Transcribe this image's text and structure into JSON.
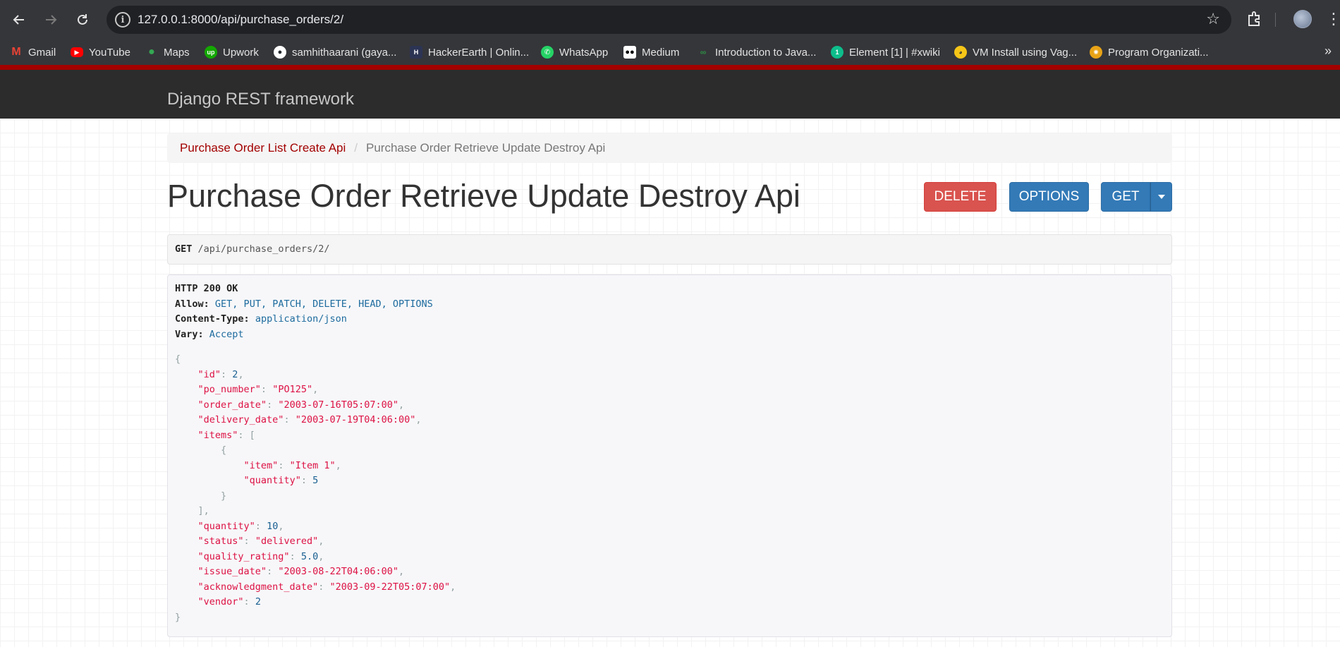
{
  "browser": {
    "url": "127.0.0.1:8000/api/purchase_orders/2/",
    "bookmarks": [
      {
        "label": "Gmail",
        "icon": "gmail-icon",
        "color": "#ea4335"
      },
      {
        "label": "YouTube",
        "icon": "youtube-icon",
        "color": "#ff0000"
      },
      {
        "label": "Maps",
        "icon": "maps-icon",
        "color": "#34a853"
      },
      {
        "label": "Upwork",
        "icon": "upwork-icon",
        "color": "#14a800"
      },
      {
        "label": "samhithaarani (gaya...",
        "icon": "github-icon",
        "color": "#ffffff"
      },
      {
        "label": "HackerEarth | Onlin...",
        "icon": "hackerearth-icon",
        "color": "#2c3454"
      },
      {
        "label": "WhatsApp",
        "icon": "whatsapp-icon",
        "color": "#25d366"
      },
      {
        "label": "Medium",
        "icon": "medium-icon",
        "color": "#000000"
      },
      {
        "label": "Introduction to Java...",
        "icon": "geeksforgeeks-icon",
        "color": "#2f8d46"
      },
      {
        "label": "Element [1] | #xwiki",
        "icon": "element-icon",
        "color": "#0dbd8b"
      },
      {
        "label": "VM Install using Vag...",
        "icon": "duck-icon",
        "color": "#f5c518"
      },
      {
        "label": "Program Organizati...",
        "icon": "program-icon",
        "color": "#e8a317"
      }
    ]
  },
  "drf": {
    "brand": "Django REST framework",
    "breadcrumb": {
      "link": "Purchase Order List Create Api",
      "separator": "/",
      "active": "Purchase Order Retrieve Update Destroy Api"
    },
    "title": "Purchase Order Retrieve Update Destroy Api",
    "buttons": {
      "delete": "DELETE",
      "options": "OPTIONS",
      "get": "GET"
    },
    "request": {
      "method": "GET",
      "path": "/api/purchase_orders/2/"
    },
    "response": {
      "status": "HTTP 200 OK",
      "allow_key": "Allow:",
      "allow_value": "GET, PUT, PATCH, DELETE, HEAD, OPTIONS",
      "content_type_key": "Content-Type:",
      "content_type_value": "application/json",
      "vary_key": "Vary:",
      "vary_value": "Accept"
    },
    "json": {
      "id": "2",
      "po_number": "\"PO125\"",
      "order_date": "\"2003-07-16T05:07:00\"",
      "delivery_date": "\"2003-07-19T04:06:00\"",
      "item": "\"Item 1\"",
      "item_quantity": "5",
      "quantity": "10",
      "status": "\"delivered\"",
      "quality_rating": "5.0",
      "issue_date": "\"2003-08-22T04:06:00\"",
      "acknowledgment_date": "\"2003-09-22T05:07:00\"",
      "vendor": "2"
    },
    "colors": {
      "accent_red": "#a30000",
      "btn_danger": "#d9534f",
      "btn_primary": "#337ab7",
      "navbar": "#2c2c2c"
    }
  }
}
